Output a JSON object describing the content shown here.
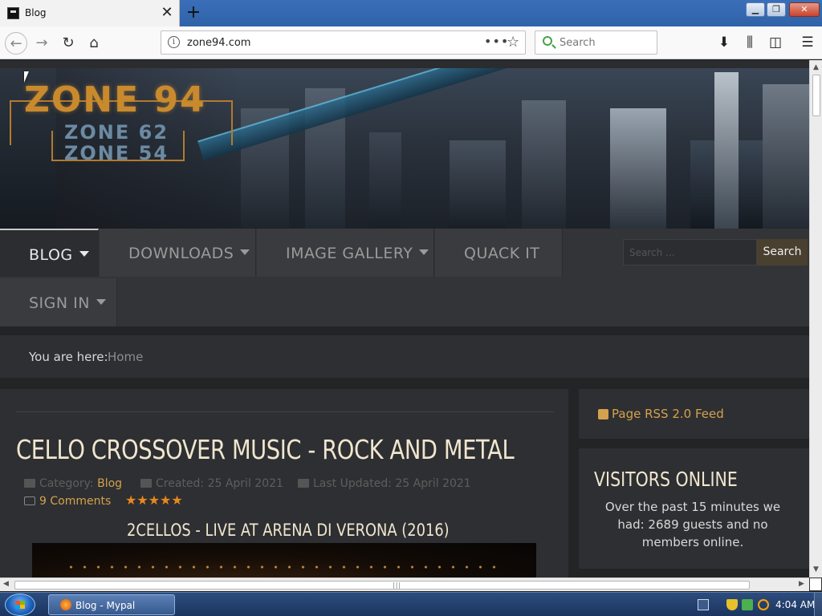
{
  "browser": {
    "tab_title": "Blog",
    "url": "zone94.com",
    "search_placeholder": "Search",
    "more_actions": "•••"
  },
  "site": {
    "logo_main": "ZONE 94",
    "logo_sub1": "ZONE 62",
    "logo_sub2": "ZONE 54",
    "menu": [
      {
        "label": "BLOG",
        "active": true
      },
      {
        "label": "DOWNLOADS",
        "active": false
      },
      {
        "label": "IMAGE GALLERY",
        "active": false
      },
      {
        "label": "QUACK IT",
        "active": false
      },
      {
        "label": "SIGN IN",
        "active": false
      }
    ],
    "search_placeholder": "Search ...",
    "search_button": "Search",
    "breadcrumb_label": "You are here:",
    "breadcrumb_home": "Home"
  },
  "article": {
    "title": "CELLO CROSSOVER MUSIC - ROCK AND METAL",
    "category_label": "Category:",
    "category": "Blog",
    "created": "Created: 25 April 2021",
    "updated": "Last Updated: 25 April 2021",
    "comments": "9 Comments",
    "rating_stars": "★★★★★",
    "rating": 5,
    "video_title": "2CELLOS - LIVE AT ARENA DI VERONA (2016)"
  },
  "sidebar": {
    "rss_label": "Page RSS 2.0 Feed",
    "visitors_title": "VISITORS ONLINE",
    "visitors_text": "Over the past 15 minutes we had: 2689 guests and no members online."
  },
  "taskbar": {
    "task_label": "Blog - Mypal",
    "clock": "4:04 AM"
  },
  "colors": {
    "accent": "#d4a24c",
    "heading": "#f0e6cf",
    "panel": "#2e2f32",
    "background": "#232426",
    "star": "#e8891c"
  }
}
